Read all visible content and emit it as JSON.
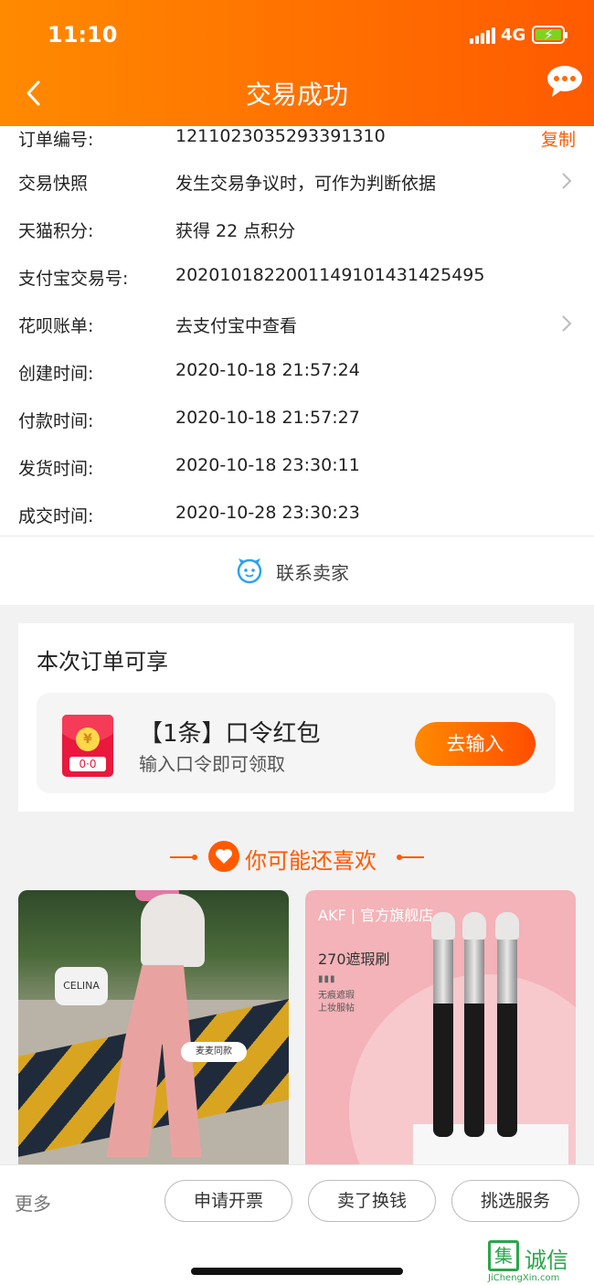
{
  "status_bar": {
    "time": "11:10",
    "network": "4G"
  },
  "header": {
    "title": "交易成功"
  },
  "details": [
    {
      "label": "订单编号:",
      "value": "1211023035293391310",
      "action": "复制"
    },
    {
      "label": "交易快照",
      "value": "发生交易争议时，可作为判断依据"
    },
    {
      "label": "天猫积分:",
      "value": "获得 22 点积分"
    },
    {
      "label": "支付宝交易号:",
      "value": "2020101822001149101431425495"
    },
    {
      "label": "花呗账单:",
      "value": "去支付宝中查看"
    },
    {
      "label": "创建时间:",
      "value": "2020-10-18 21:57:24"
    },
    {
      "label": "付款时间:",
      "value": "2020-10-18 21:57:27"
    },
    {
      "label": "发货时间:",
      "value": "2020-10-18 23:30:11"
    },
    {
      "label": "成交时间:",
      "value": "2020-10-28 23:30:23"
    }
  ],
  "contact": {
    "label": "联系卖家"
  },
  "benefit": {
    "title": "本次订单可享",
    "coupon_title": "【1条】口令红包",
    "coupon_subtitle": "输入口令即可领取",
    "coupon_button": "去输入",
    "envelope_code": "0·0"
  },
  "recommend": {
    "title": "你可能还喜欢",
    "products": [
      {
        "bag_text": "CELINA",
        "tag_text": "麦麦同款"
      },
      {
        "brand": "AKF | 官方旗舰店",
        "name": "270遮瑕刷",
        "dots": "▮▮▮",
        "sub1": "无痕遮瑕",
        "sub2": "上妆服帖"
      }
    ]
  },
  "bottom_bar": {
    "more": "更多",
    "buttons": [
      "申请开票",
      "卖了换钱",
      "挑选服务"
    ]
  },
  "watermark": {
    "text": "诚信",
    "box": "集",
    "url": "JiChengXin.com"
  },
  "colors": {
    "accent": "#ff5a00",
    "header_start": "#ff8a00"
  }
}
